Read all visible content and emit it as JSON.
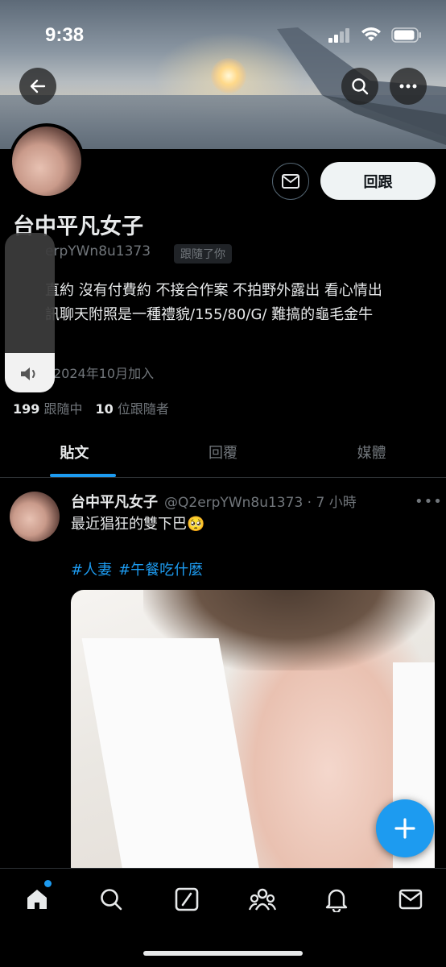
{
  "status_bar": {
    "time": "9:38"
  },
  "profile": {
    "display_name": "台中平凡女子",
    "handle_visible": "erpYWn8u1373",
    "follows_you_badge": "跟隨了你",
    "follow_back_label": "回跟",
    "bio_line1": "直約 沒有付費約 不接合作案 不拍野外露出 看心情出",
    "bio_line2": "訊聊天附照是一種禮貌/155/80/G/ 難搞的龜毛金牛",
    "joined": "2024年10月加入",
    "following_count": "199",
    "following_label": "跟隨中",
    "followers_count": "10",
    "followers_label": "位跟隨者"
  },
  "volume_hud": {
    "level": 0.25
  },
  "tabs": [
    {
      "label": "貼文",
      "active": true
    },
    {
      "label": "回覆",
      "active": false
    },
    {
      "label": "媒體",
      "active": false
    }
  ],
  "post": {
    "author": "台中平凡女子",
    "meta": "@Q2erpYWn8u1373 · 7 小時",
    "text": "最近猖狂的雙下巴🥺",
    "hashtags": [
      "#人妻",
      "#午餐吃什麼"
    ]
  },
  "fab": {
    "icon": "plus-icon"
  },
  "bottom_nav": [
    "home-icon",
    "search-icon",
    "grok-icon",
    "communities-icon",
    "notifications-icon",
    "messages-icon"
  ],
  "colors": {
    "accent": "#1d9bf0",
    "background": "#000000",
    "muted": "#71767b"
  }
}
